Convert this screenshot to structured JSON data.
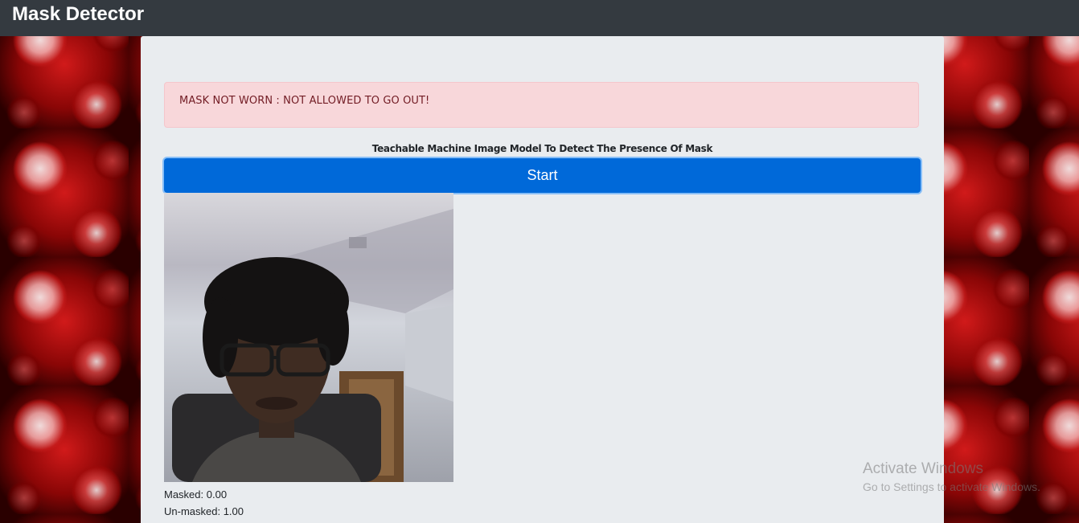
{
  "navbar": {
    "brand": "Mask Detector"
  },
  "alert": {
    "message": "MASK NOT WORN : NOT ALLOWED TO GO OUT!"
  },
  "main": {
    "heading": "Teachable Machine Image Model To Detect The Presence Of Mask",
    "start_button": "Start",
    "predictions": [
      {
        "text": "Masked: 0.00"
      },
      {
        "text": "Un-masked: 1.00"
      }
    ]
  },
  "watermark": {
    "title": "Activate Windows",
    "subtitle": "Go to Settings to activate Windows."
  },
  "colors": {
    "navbar_bg": "#343a40",
    "panel_bg": "#e9ecef",
    "alert_bg": "#f8d7da",
    "alert_text": "#721c24",
    "button_bg": "#0069d9"
  }
}
